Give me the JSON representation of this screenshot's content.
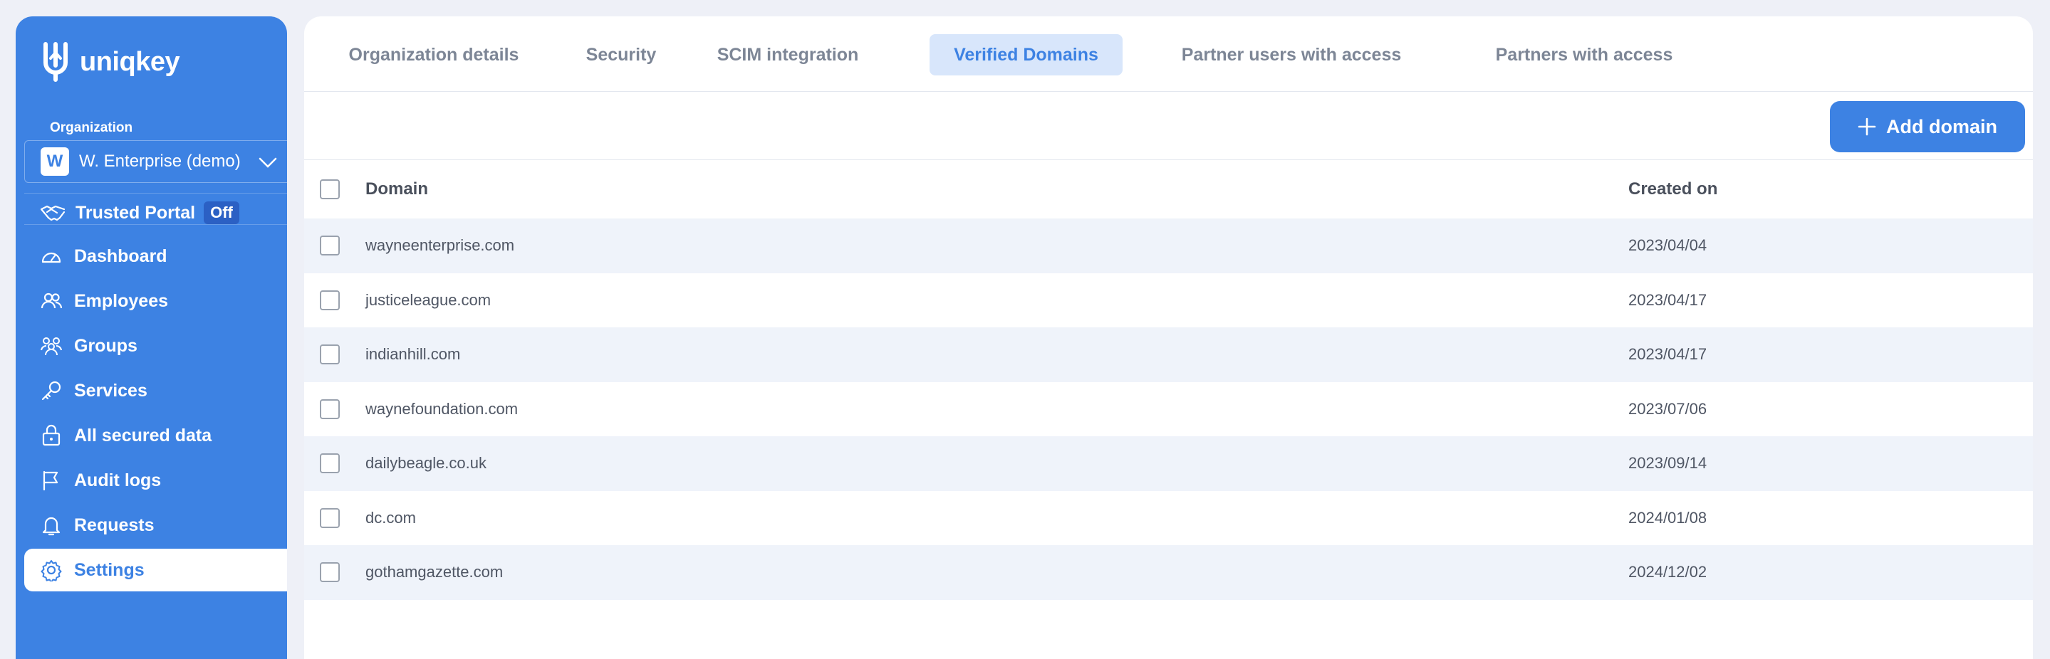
{
  "app": {
    "logo_text": "uniqkey"
  },
  "sidebar": {
    "org_label": "Organization",
    "org_initial": "W",
    "org_name": "W. Enterprise (demo)",
    "trusted_portal": {
      "label": "Trusted Portal",
      "status": "Off"
    },
    "items": [
      {
        "label": "Dashboard",
        "icon": "gauge-icon"
      },
      {
        "label": "Employees",
        "icon": "users-icon"
      },
      {
        "label": "Groups",
        "icon": "group-icon"
      },
      {
        "label": "Services",
        "icon": "key-icon"
      },
      {
        "label": "All secured data",
        "icon": "lock-icon"
      },
      {
        "label": "Audit logs",
        "icon": "flag-icon"
      },
      {
        "label": "Requests",
        "icon": "bell-icon"
      },
      {
        "label": "Settings",
        "icon": "gear-icon",
        "active": true
      }
    ]
  },
  "tabs": [
    {
      "label": "Organization details"
    },
    {
      "label": "Security"
    },
    {
      "label": "SCIM integration"
    },
    {
      "label": "Verified Domains",
      "active": true
    },
    {
      "label": "Partner users with access"
    },
    {
      "label": "Partners with access"
    }
  ],
  "toolbar": {
    "add_label": "Add domain"
  },
  "table": {
    "columns": [
      "Domain",
      "Created on"
    ],
    "rows": [
      {
        "domain": "wayneenterprise.com",
        "created": "2023/04/04"
      },
      {
        "domain": "justiceleague.com",
        "created": "2023/04/17"
      },
      {
        "domain": "indianhill.com",
        "created": "2023/04/17"
      },
      {
        "domain": "waynefoundation.com",
        "created": "2023/07/06"
      },
      {
        "domain": "dailybeagle.co.uk",
        "created": "2023/09/14"
      },
      {
        "domain": "dc.com",
        "created": "2024/01/08"
      },
      {
        "domain": "gothamgazette.com",
        "created": "2024/12/02"
      }
    ]
  },
  "colors": {
    "brand": "#3d82e3",
    "active_tab_bg": "#d8e6fb",
    "stripe": "#eff3fa"
  }
}
